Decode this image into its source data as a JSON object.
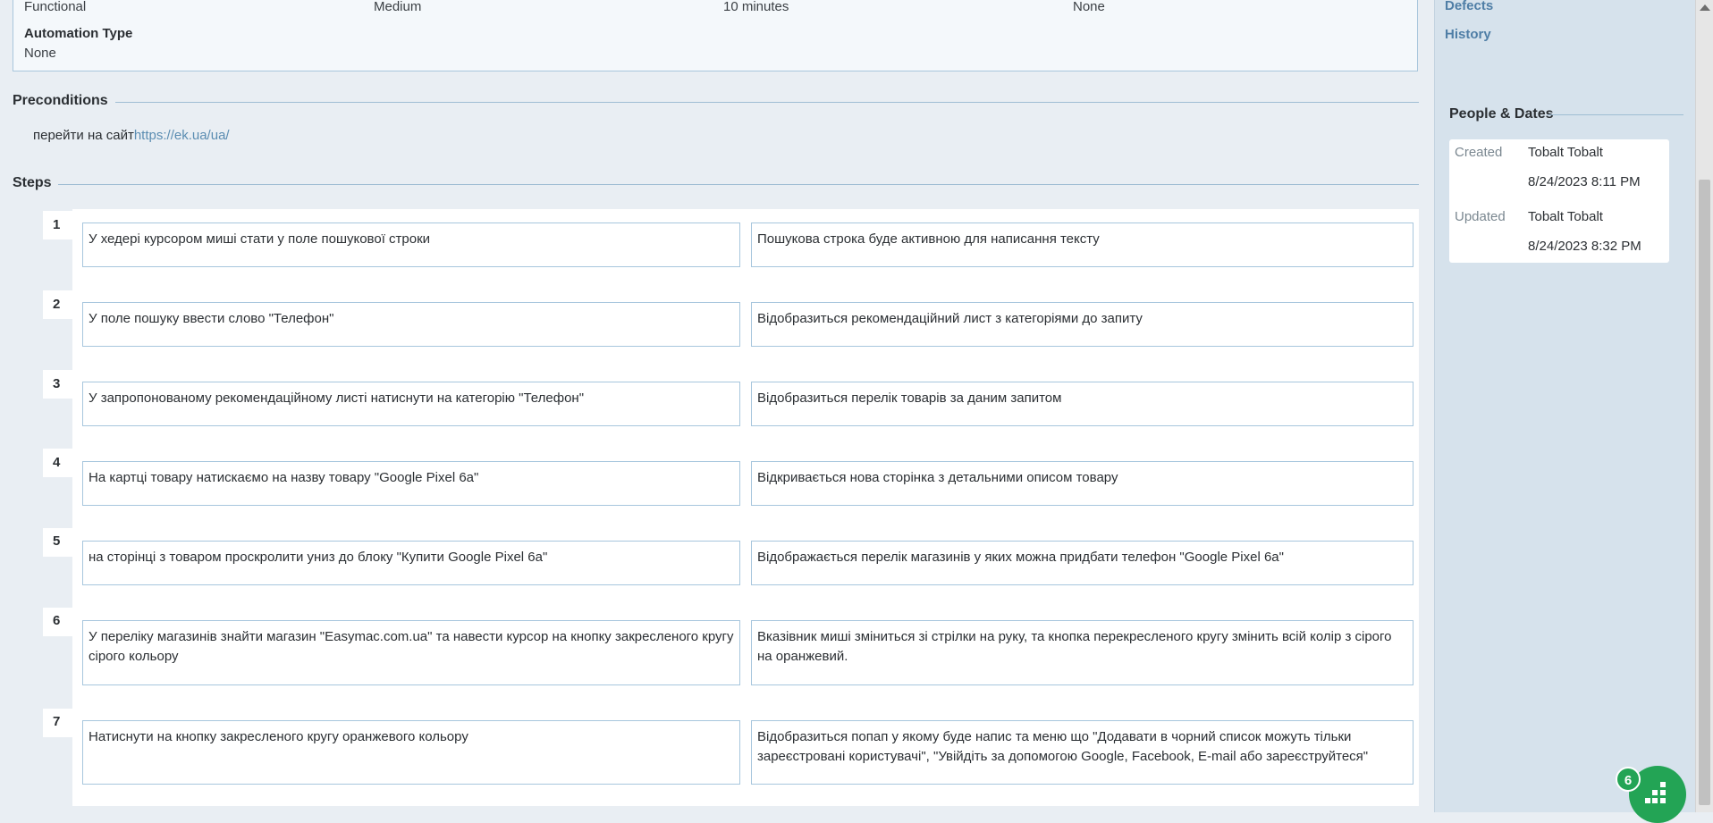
{
  "properties": {
    "type": "Functional",
    "priority": "Medium",
    "estimate": "10 minutes",
    "risk": "None",
    "automation_label": "Automation Type",
    "automation_value": "None"
  },
  "preconditions": {
    "title": "Preconditions",
    "text": "перейти на сайт",
    "link": "https://ek.ua/ua/"
  },
  "steps": {
    "title": "Steps",
    "items": [
      {
        "num": "1",
        "action": "У хедері курсором миші стати у поле пошукової строки",
        "expected": "Пошукова строка буде активною для написання тексту"
      },
      {
        "num": "2",
        "action": "У поле пошуку ввести слово \"Телефон\"",
        "expected": "Відобразиться рекомендаційний лист з категоріями до запиту"
      },
      {
        "num": "3",
        "action": "У запропонованому рекомендаційному листі натиснути на категорію \"Телефон\"",
        "expected": "Відобразиться перелік товарів за даним запитом"
      },
      {
        "num": "4",
        "action": "На картці товару натискаємо на назву товару \"Google Pixel 6a\"",
        "expected": "Відкривається нова сторінка з детальними описом товару"
      },
      {
        "num": "5",
        "action": "на сторінці з товаром проскролити униз до блоку \"Купити Google Pixel 6a\"",
        "expected": "Відображається перелік магазинів у яких можна придбати телефон \"Google Pixel 6a\""
      },
      {
        "num": "6",
        "action": "У переліку магазинів знайти магазин \"Easymac.com.ua\" та навести курсор на кнопку закресленого кругу сірого кольору",
        "expected": "Вказівник миші зміниться зі стрілки на руку, та кнопка перекресленого кругу змінить всій колір з сірого на оранжевий."
      },
      {
        "num": "7",
        "action": "Натиснути на кнопку закресленого кругу оранжевого кольору",
        "expected": "Відобразиться попап у якому буде напис та меню що \"Додавати в чорний список можуть тільки зареєстровані користувачі\", \"Увійдіть за допомогою Google, Facebook, E-mail або зареєструйтеся\""
      }
    ]
  },
  "sidebar": {
    "links": [
      "Defects",
      "History"
    ],
    "people_dates": {
      "title": "People & Dates",
      "created_label": "Created",
      "created_by": "Tobalt Tobalt",
      "created_at": "8/24/2023 8:11 PM",
      "updated_label": "Updated",
      "updated_by": "Tobalt Tobalt",
      "updated_at": "8/24/2023 8:32 PM"
    }
  },
  "widget": {
    "badge_count": "6",
    "icon": "grid-dots-icon",
    "color": "#23a455"
  },
  "colors": {
    "background": "#e9eef3",
    "sidebar": "#d6e2ec",
    "link": "#5b8db2",
    "border": "#a7c6dd"
  }
}
